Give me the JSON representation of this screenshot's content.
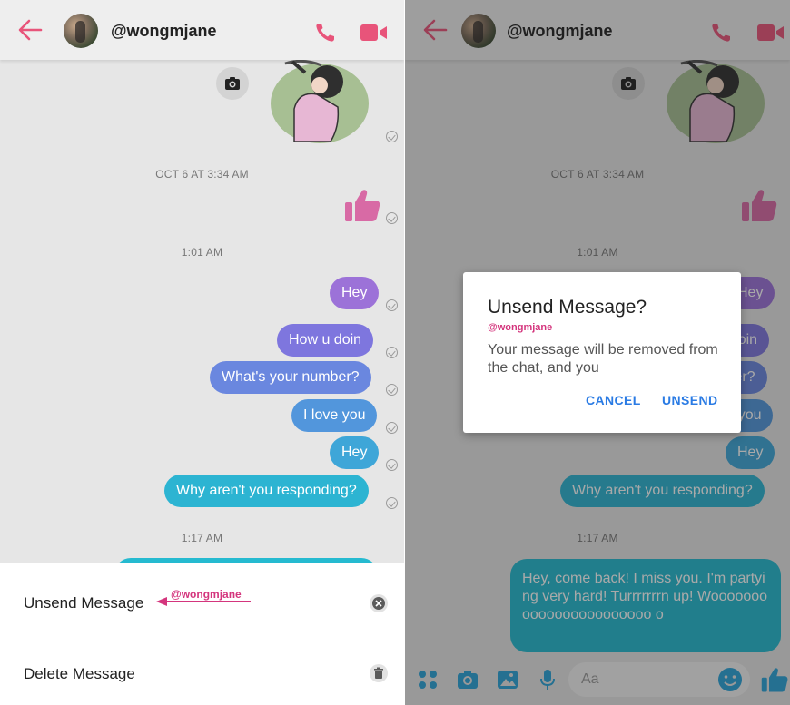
{
  "header": {
    "username": "@wongmjane"
  },
  "timestamps": {
    "first": "OCT 6 AT 3:34 AM",
    "second": "1:01 AM",
    "third": "1:17 AM"
  },
  "messages": [
    {
      "text": "Hey"
    },
    {
      "text": "How u doin"
    },
    {
      "text": "What's your number?"
    },
    {
      "text": "I love you"
    },
    {
      "text": "Hey"
    },
    {
      "text": "Why aren't you responding?"
    }
  ],
  "long_message": {
    "text": "Hey, come back! I miss you. I'm partying very hard! Turrrrrrrn up! Wooooooooooooooooooooooo o"
  },
  "action_sheet": {
    "unsend_label": "Unsend Message",
    "delete_label": "Delete Message",
    "annotation": "@wongmjane"
  },
  "composer": {
    "placeholder": "Aa"
  },
  "dialog": {
    "title": "Unsend Message?",
    "watermark": "@wongmjane",
    "body": "Your message will be removed from the chat, and you",
    "cancel_label": "CANCEL",
    "unsend_label": "UNSEND"
  },
  "colors": {
    "accent": "#e8547a",
    "link_blue": "#2a7be4",
    "annotation_pink": "#d4357d",
    "thumb_pink": "#d86aa5"
  },
  "icons": [
    "back-arrow-icon",
    "phone-icon",
    "video-camera-icon",
    "camera-icon",
    "thumbs-up-icon",
    "sent-check-icon",
    "close-circle-icon",
    "trash-icon",
    "apps-icon",
    "image-icon",
    "microphone-icon",
    "emoji-icon"
  ]
}
